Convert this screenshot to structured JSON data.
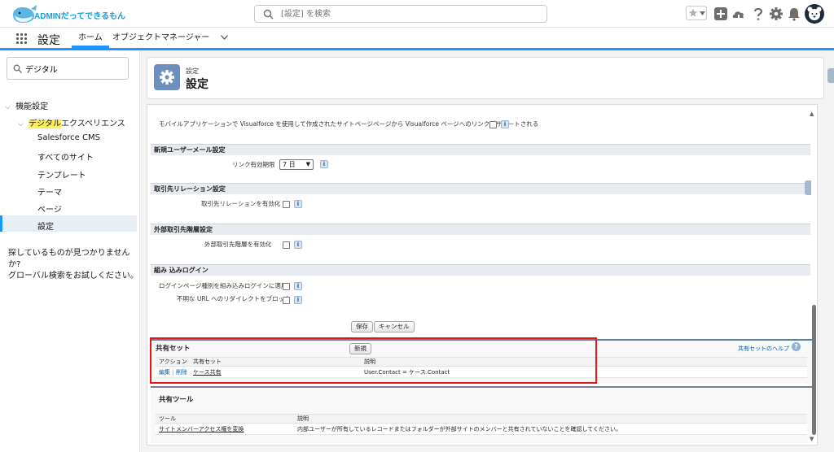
{
  "header": {
    "logo_text": "ADMINだってできるもん",
    "search_placeholder": "[設定] を検索"
  },
  "nav": {
    "app_name": "設定",
    "tabs": [
      {
        "label": "ホーム"
      },
      {
        "label": "オブジェクトマネージャー"
      }
    ]
  },
  "sidebar": {
    "quickfind_value": "デジタル",
    "tree": {
      "root": "機能設定",
      "group_prefix": "",
      "group_highlight": "デジタル",
      "group_suffix": "エクスペリエンス",
      "items": [
        {
          "label": "Salesforce CMS"
        },
        {
          "label": "すべてのサイト"
        },
        {
          "label": "テンプレート"
        },
        {
          "label": "テーマ"
        },
        {
          "label": "ページ"
        },
        {
          "label": "設定"
        }
      ]
    },
    "help_line1": "探しているものが見つかりませんか?",
    "help_line2": "グローバル検索をお試しください。"
  },
  "page_header": {
    "breadcrumb": "設定",
    "title": "設定"
  },
  "settings": {
    "top_row_label": "モバイルアプリケーションで Visualforce を使用して作成されたサイトページページから Visualforce ページへのリンクがサポートされる",
    "sections": [
      {
        "title": "新規ユーザーメール設定",
        "fields": [
          {
            "label": "リンク有効期限",
            "value": "7 日"
          }
        ]
      },
      {
        "title": "取引先リレーション設定",
        "fields": [
          {
            "label": "取引先リレーションを有効化"
          }
        ]
      },
      {
        "title": "外部取引先階層設定",
        "fields": [
          {
            "label": "外部取引先階層を有効化"
          }
        ]
      },
      {
        "title": "組み 込みログイン",
        "fields": [
          {
            "label": "ログインページ種別を組み込みログインに適用"
          },
          {
            "label": "不明な URL へのリダイレクトをブロック"
          }
        ]
      }
    ],
    "save_label": "保存",
    "cancel_label": "キャンセル"
  },
  "sharing_sets": {
    "title": "共有セット",
    "new_label": "新規",
    "help_link": "共有セットのヘルプ",
    "columns": [
      "アクション",
      "共有セット",
      "説明"
    ],
    "rows": [
      {
        "edit": "編集",
        "sep": "|",
        "delete": "削除",
        "name": "ケース共有",
        "description": "User.Contact = ケース.Contact"
      }
    ]
  },
  "sharing_tools": {
    "title": "共有ツール",
    "columns": [
      "ツール",
      "説明"
    ],
    "rows": [
      {
        "name": "サイトメンバーアクセス権を変換",
        "description": "内部ユーザーが所有しているレコードまたはフォルダーが外部サイトのメンバーと共有されていないことを確認してください。"
      }
    ]
  },
  "colors": {
    "accent": "#1b96ff",
    "setup_tile": "#6d8fbd",
    "highlight_box": "#e8161b",
    "logo": "#1a9bd7"
  }
}
